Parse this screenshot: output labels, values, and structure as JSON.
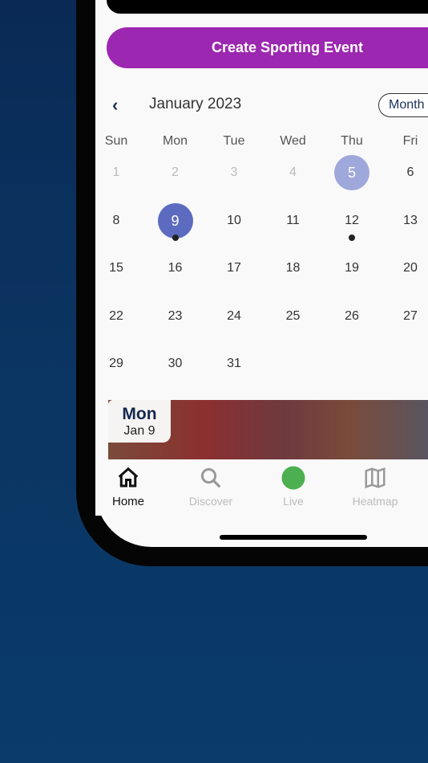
{
  "actions": {
    "create_event": "Create Sporting Event"
  },
  "calendar": {
    "title": "January 2023",
    "view_toggle": "Month",
    "weekdays": [
      "Sun",
      "Mon",
      "Tue",
      "Wed",
      "Thu",
      "Fri"
    ],
    "today": 5,
    "selected": 9,
    "event_days": [
      9,
      12
    ],
    "weeks": [
      [
        "1",
        "2",
        "3",
        "4",
        "5",
        "6"
      ],
      [
        "8",
        "9",
        "10",
        "11",
        "12",
        "13"
      ],
      [
        "15",
        "16",
        "17",
        "18",
        "19",
        "20"
      ],
      [
        "22",
        "23",
        "24",
        "25",
        "26",
        "27"
      ],
      [
        "29",
        "30",
        "31",
        "",
        "",
        ""
      ]
    ],
    "muted_days": [
      "1",
      "2",
      "3",
      "4"
    ]
  },
  "event_card": {
    "weekday": "Mon",
    "date": "Jan 9"
  },
  "tabbar": {
    "items": [
      {
        "label": "Home",
        "icon": "home-icon",
        "active": true
      },
      {
        "label": "Discover",
        "icon": "search-icon"
      },
      {
        "label": "Live",
        "icon": "live-dot-icon",
        "color": "#4caf50"
      },
      {
        "label": "Heatmap",
        "icon": "map-icon"
      }
    ]
  },
  "colors": {
    "accent": "#9c27b0",
    "selected": "#5c6bc0",
    "today": "#9fa8da"
  }
}
